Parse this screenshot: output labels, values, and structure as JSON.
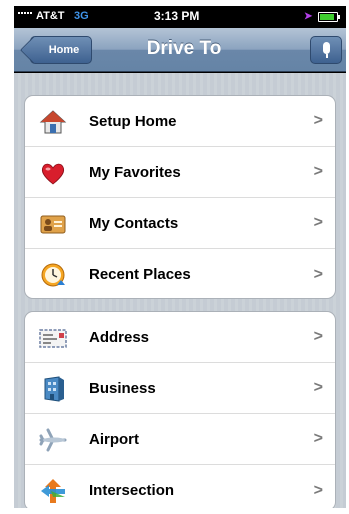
{
  "status_bar": {
    "carrier": "AT&T",
    "network": "3G",
    "time": "3:13 PM",
    "battery_level": 0.8
  },
  "nav_bar": {
    "back_label": "Home",
    "title": "Drive To"
  },
  "groups": [
    {
      "items": [
        {
          "label": "Setup Home",
          "icon": "house-icon"
        },
        {
          "label": "My Favorites",
          "icon": "heart-icon"
        },
        {
          "label": "My Contacts",
          "icon": "contact-card-icon"
        },
        {
          "label": "Recent Places",
          "icon": "clock-icon"
        }
      ]
    },
    {
      "items": [
        {
          "label": "Address",
          "icon": "address-envelope-icon"
        },
        {
          "label": "Business",
          "icon": "business-building-icon"
        },
        {
          "label": "Airport",
          "icon": "airplane-icon"
        },
        {
          "label": "Intersection",
          "icon": "intersection-arrows-icon"
        }
      ]
    }
  ],
  "chevron": ">"
}
